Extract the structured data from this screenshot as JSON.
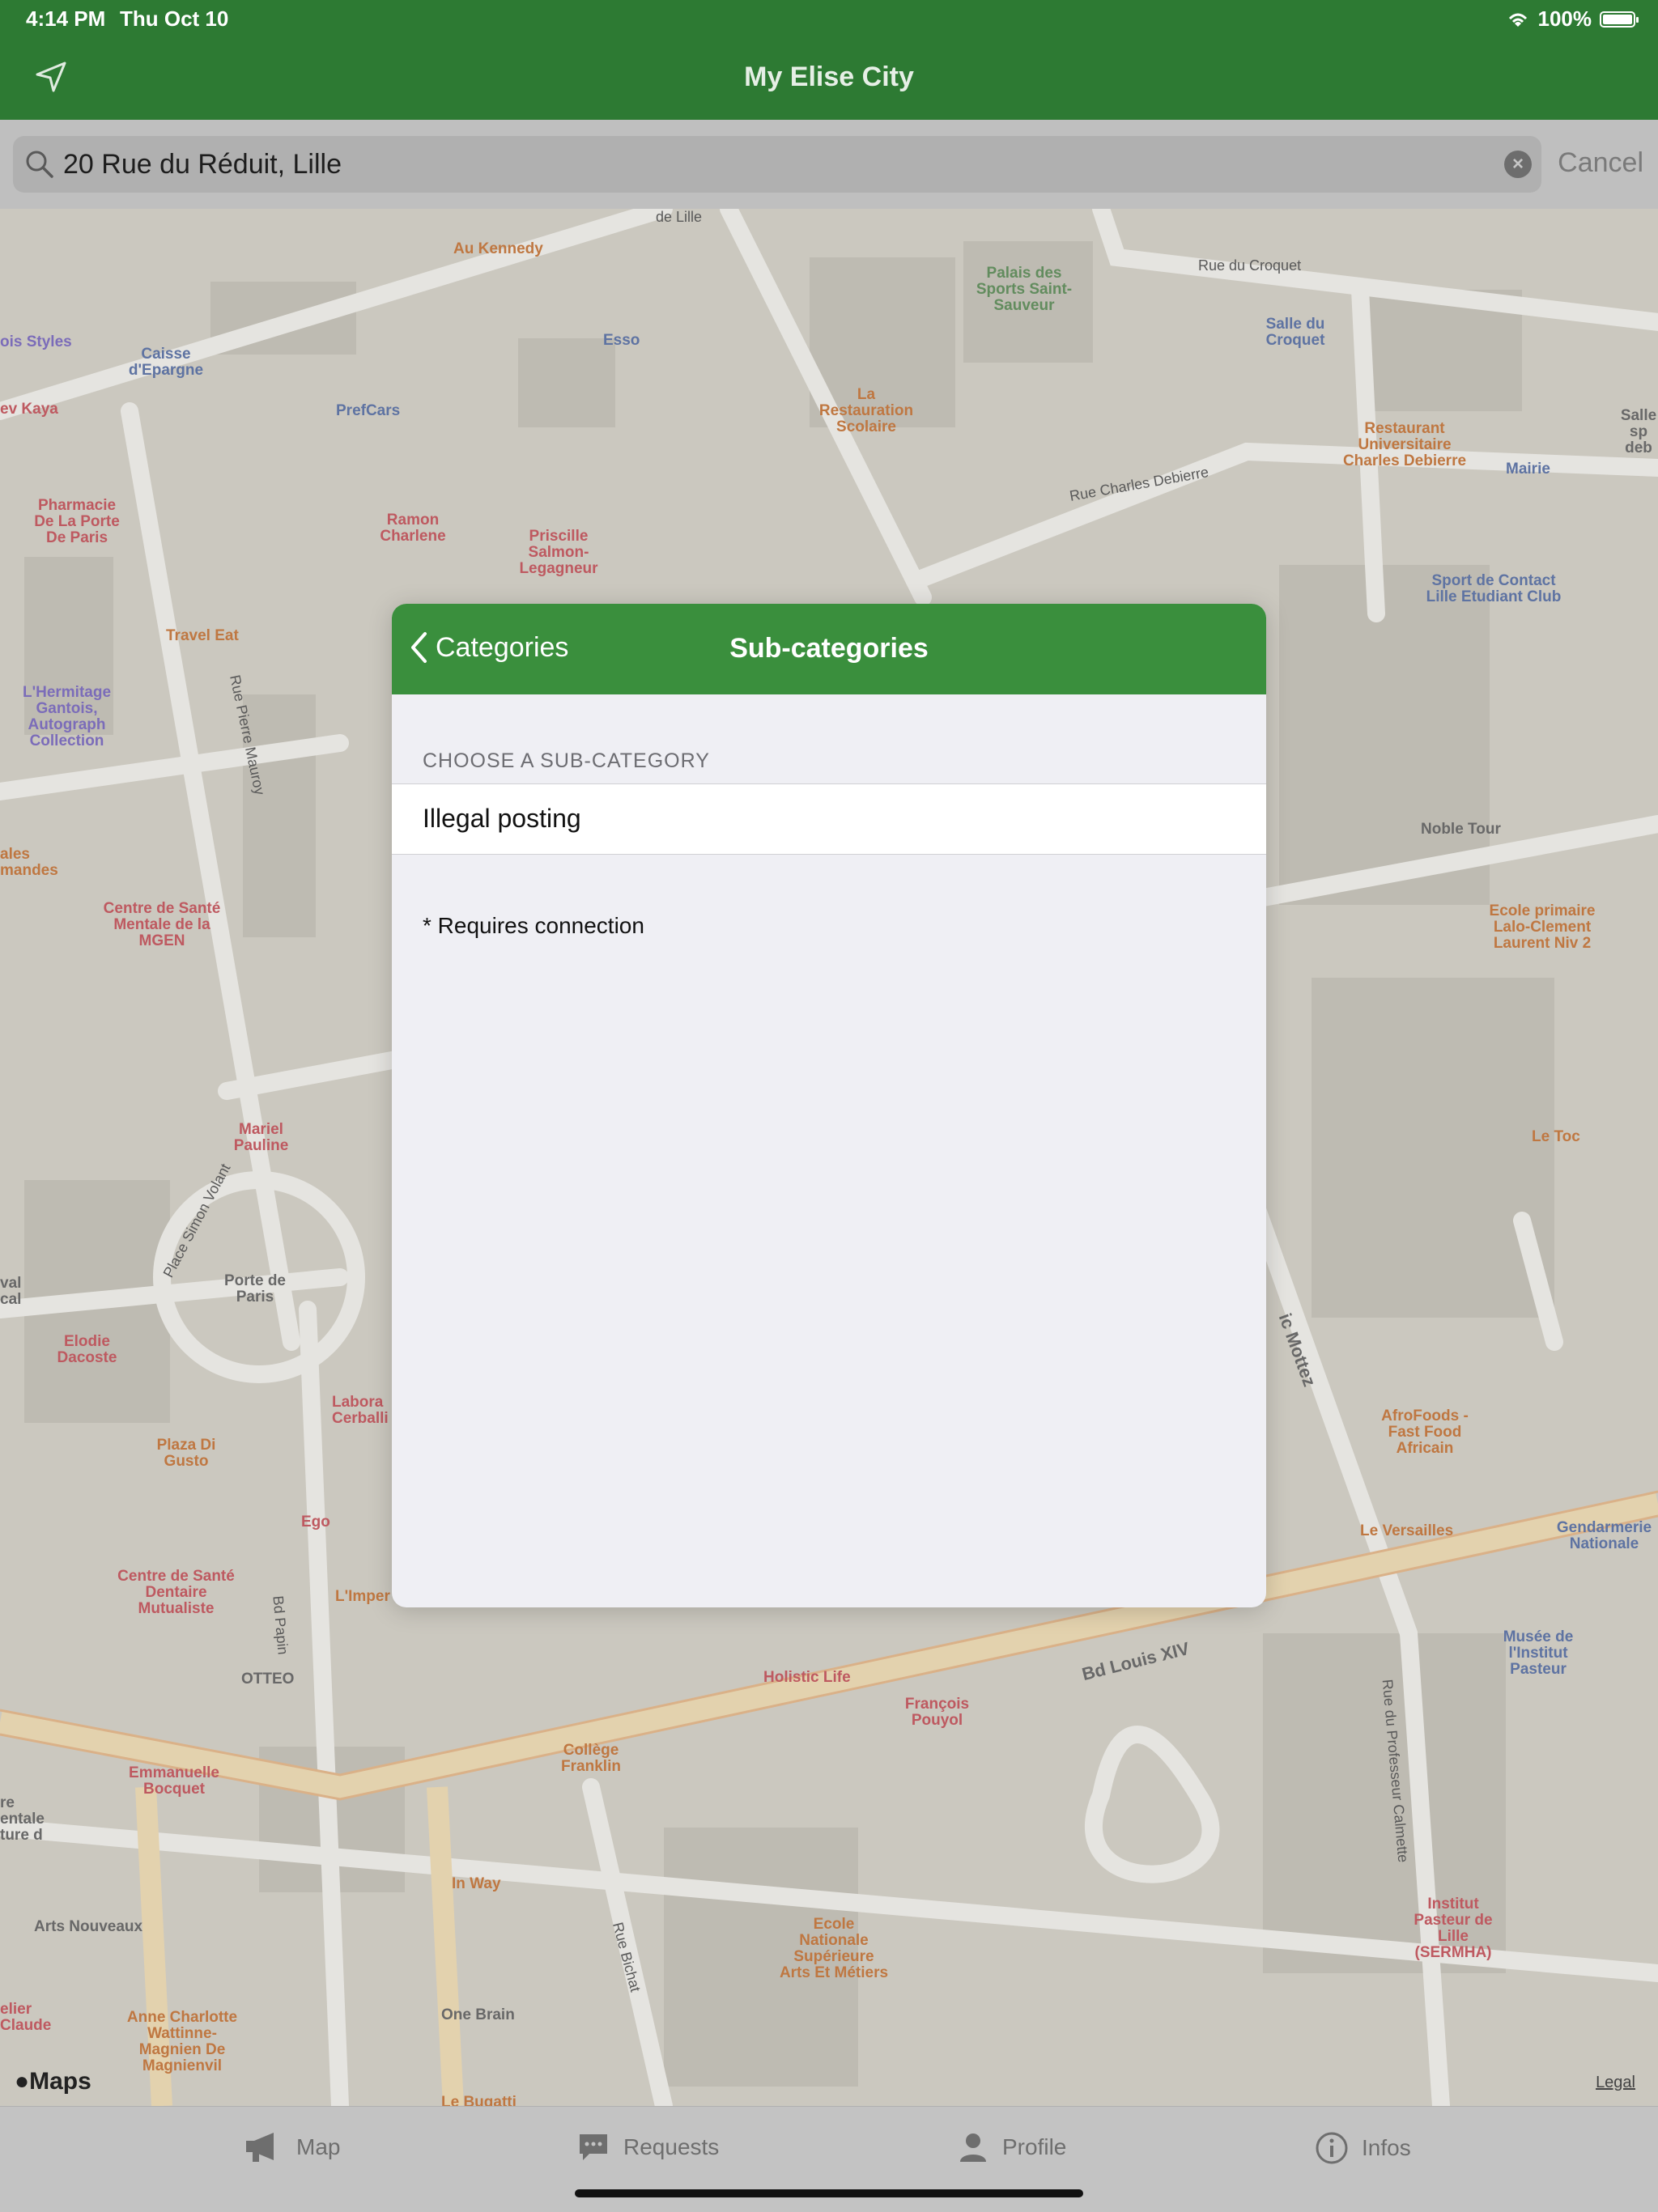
{
  "status": {
    "time": "4:14 PM",
    "date": "Thu Oct 10",
    "battery": "100%"
  },
  "nav": {
    "title": "My Elise City"
  },
  "search": {
    "value": "20 Rue du Réduit, Lille",
    "cancel": "Cancel"
  },
  "map": {
    "labels": {
      "de_lille": "de Lille",
      "au_kennedy": "Au Kennedy",
      "palais": "Palais des Sports Saint-Sauveur",
      "rue_croquet": "Rue du Croquet",
      "bois_styles": "ois Styles",
      "caisse": "Caisse d'Epargne",
      "esso": "Esso",
      "salle_croquet": "Salle du Croquet",
      "salle_sp": "Salle sp deb",
      "kaya": "ev Kaya",
      "prefcars": "PrefCars",
      "la_restauration": "La Restauration Scolaire",
      "resto_univ": "Restaurant Universitaire Charles Debierre",
      "mairie": "Mairie",
      "pharmacie": "Pharmacie De La Porte De Paris",
      "ramon": "Ramon Charlene",
      "priscille": "Priscille Salmon-Legagneur",
      "rue_charles": "Rue Charles Debierre",
      "sport_contact": "Sport de Contact Lille Etudiant Club",
      "travel_eat": "Travel Eat",
      "hermitage": "L'Hermitage Gantois, Autograph Collection",
      "rue_pierre": "Rue Pierre Mauroy",
      "noble_tour": "Noble Tour",
      "ales_mandes": "ales mandes",
      "centre_mgen": "Centre de Santé Mentale de la MGEN",
      "ecole_lalo": "Ecole primaire Lalo-Clement Laurent Niv 2",
      "le_toc": "Le Toc",
      "mariel": "Mariel Pauline",
      "place_simon": "Place Simon Volant",
      "porte_paris": "Porte de Paris",
      "val_cal": "val cal",
      "elodie": "Elodie Dacoste",
      "labora": "Labora Cerballi",
      "mottez": "ic Mottez",
      "afrofoods": "AfroFoods - Fast Food Africain",
      "plaza": "Plaza Di Gusto",
      "ego": "Ego",
      "le_versailles": "Le Versailles",
      "gendarmerie": "Gendarmerie Nationale",
      "centre_dentaire": "Centre de Santé Dentaire Mutualiste",
      "bd_papin": "Bd Papin",
      "limper": "L'Imper",
      "musee": "Musée de l'Institut Pasteur",
      "otteo": "OTTEO",
      "holistic": "Holistic Life",
      "bd_louis": "Bd Louis XIV",
      "francois": "François Pouyol",
      "rue_calmette": "Rue du Professeur Calmette",
      "college": "Collège Franklin",
      "emmanuelle": "Emmanuelle Bocquet",
      "re_entale": "re entale ture d",
      "in_way": "In Way",
      "arts_nouveaux": "Arts Nouveaux",
      "ecole_nat": "Ecole Nationale Supérieure Arts Et Métiers",
      "rue_bichat": "Rue Bichat",
      "institut": "Institut Pasteur de Lille (SERMHA)",
      "one_brain": "One Brain",
      "elier": "elier Claude",
      "anne": "Anne Charlotte Wattinne-Magnien De Magnienvil",
      "le_bugatti": "Le Bugatti"
    },
    "maps_logo": "Maps",
    "legal": "Legal"
  },
  "modal": {
    "back_label": "Categories",
    "title": "Sub-categories",
    "section_header": "CHOOSE A SUB-CATEGORY",
    "items": [
      {
        "label": "Illegal posting"
      }
    ],
    "footnote": "* Requires connection"
  },
  "tabs": [
    {
      "label": "Map",
      "icon": "megaphone-icon"
    },
    {
      "label": "Requests",
      "icon": "chat-bubble-icon"
    },
    {
      "label": "Profile",
      "icon": "person-icon"
    },
    {
      "label": "Infos",
      "icon": "info-circle-icon"
    }
  ],
  "colors": {
    "header_green": "#2d7a33",
    "modal_header_green": "#3a8f3d"
  }
}
